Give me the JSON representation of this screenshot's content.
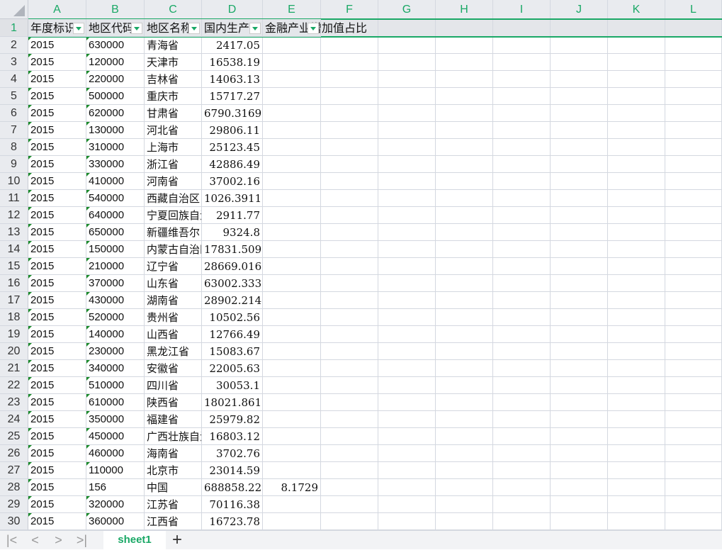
{
  "columns": [
    "A",
    "B",
    "C",
    "D",
    "E",
    "F",
    "G",
    "H",
    "I",
    "J",
    "K",
    "L"
  ],
  "headers": [
    "年度标识",
    "地区代码",
    "地区名称",
    "国内生产总值",
    "金融产业增加值占比"
  ],
  "rows": [
    [
      "2015",
      "630000",
      "青海省",
      "2417.05",
      ""
    ],
    [
      "2015",
      "120000",
      "天津市",
      "16538.19",
      ""
    ],
    [
      "2015",
      "220000",
      "吉林省",
      "14063.13",
      ""
    ],
    [
      "2015",
      "500000",
      "重庆市",
      "15717.27",
      ""
    ],
    [
      "2015",
      "620000",
      "甘肃省",
      "6790.3169",
      ""
    ],
    [
      "2015",
      "130000",
      "河北省",
      "29806.11",
      ""
    ],
    [
      "2015",
      "310000",
      "上海市",
      "25123.45",
      ""
    ],
    [
      "2015",
      "330000",
      "浙江省",
      "42886.49",
      ""
    ],
    [
      "2015",
      "410000",
      "河南省",
      "37002.16",
      ""
    ],
    [
      "2015",
      "540000",
      "西藏自治区",
      "1026.3911",
      ""
    ],
    [
      "2015",
      "640000",
      "宁夏回族自治区",
      "2911.77",
      ""
    ],
    [
      "2015",
      "650000",
      "新疆维吾尔自治区",
      "9324.8",
      ""
    ],
    [
      "2015",
      "150000",
      "内蒙古自治区",
      "17831.509",
      ""
    ],
    [
      "2015",
      "210000",
      "辽宁省",
      "28669.016",
      ""
    ],
    [
      "2015",
      "370000",
      "山东省",
      "63002.333",
      ""
    ],
    [
      "2015",
      "430000",
      "湖南省",
      "28902.214",
      ""
    ],
    [
      "2015",
      "520000",
      "贵州省",
      "10502.56",
      ""
    ],
    [
      "2015",
      "140000",
      "山西省",
      "12766.49",
      ""
    ],
    [
      "2015",
      "230000",
      "黑龙江省",
      "15083.67",
      ""
    ],
    [
      "2015",
      "340000",
      "安徽省",
      "22005.63",
      ""
    ],
    [
      "2015",
      "510000",
      "四川省",
      "30053.1",
      ""
    ],
    [
      "2015",
      "610000",
      "陕西省",
      "18021.861",
      ""
    ],
    [
      "2015",
      "350000",
      "福建省",
      "25979.82",
      ""
    ],
    [
      "2015",
      "450000",
      "广西壮族自治区",
      "16803.12",
      ""
    ],
    [
      "2015",
      "460000",
      "海南省",
      "3702.76",
      ""
    ],
    [
      "2015",
      "110000",
      "北京市",
      "23014.59",
      ""
    ],
    [
      "2015",
      "156",
      "中国",
      "688858.22",
      "8.1729"
    ],
    [
      "2015",
      "320000",
      "江苏省",
      "70116.38",
      ""
    ],
    [
      "2015",
      "360000",
      "江西省",
      "16723.78",
      ""
    ]
  ],
  "sheet_tab": "sheet1",
  "accent": "#1aa866"
}
